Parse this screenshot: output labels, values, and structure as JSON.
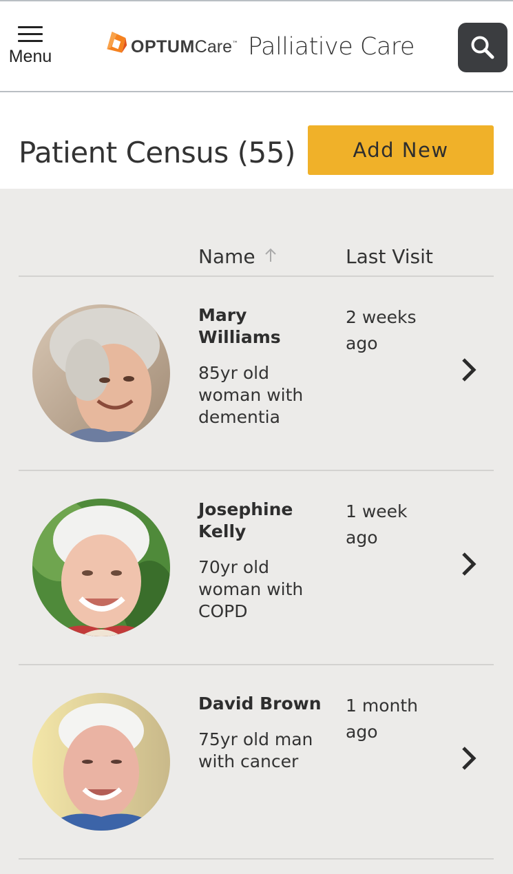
{
  "header": {
    "menu_label": "Menu",
    "logo_optum": "OPTUM",
    "logo_care": "Care",
    "logo_tm": "™",
    "app_title": "Palliative Care"
  },
  "census": {
    "title": "Patient Census (55)",
    "add_button": "Add New"
  },
  "table": {
    "columns": {
      "name": "Name",
      "last_visit": "Last Visit"
    },
    "sort": {
      "column": "Name",
      "direction": "ascending"
    },
    "rows": [
      {
        "name": "Mary Williams",
        "description": "85yr old woman with dementia",
        "last_visit": "2 weeks ago"
      },
      {
        "name": "Josephine Kelly",
        "description": "70yr old woman with COPD",
        "last_visit": "1 week ago"
      },
      {
        "name": "David Brown",
        "description": "75yr old man with cancer",
        "last_visit": "1 month ago"
      }
    ]
  },
  "colors": {
    "accent": "#f0b129",
    "search_button": "#3b3d40",
    "list_background": "#ecebe9",
    "logo_orange": "#f5821f"
  },
  "icons": [
    "hamburger-menu-icon",
    "optum-logo-icon",
    "search-icon",
    "sort-ascending-icon",
    "chevron-right-icon"
  ]
}
